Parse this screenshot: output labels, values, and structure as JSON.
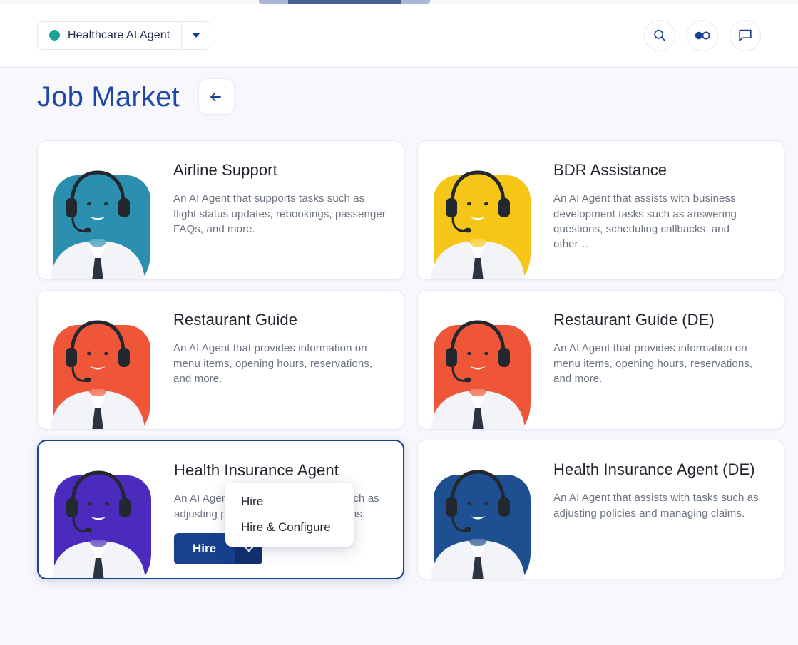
{
  "header": {
    "agent_selector": {
      "name": "Healthcare AI Agent",
      "status_color": "#17a398",
      "caret_icon": "chevron-down-icon"
    },
    "actions": [
      {
        "icon": "search-icon",
        "label": "Search"
      },
      {
        "icon": "connection-toggle-icon",
        "label": "Connections"
      },
      {
        "icon": "chat-bubble-icon",
        "label": "Chat"
      }
    ]
  },
  "page": {
    "title": "Job Market",
    "back_label": "Back",
    "back_icon": "arrow-left-icon",
    "title_color": "#1e46a5"
  },
  "cards": [
    {
      "title": "Airline Support",
      "description": "An AI Agent that supports tasks such as flight status updates, rebookings, passenger FAQs, and more.",
      "bg_color": "#2b8fb0",
      "selected": false
    },
    {
      "title": "BDR Assistance",
      "description": "An AI Agent that assists with business development tasks such as answering questions, scheduling callbacks, and other…",
      "bg_color": "#f5c518",
      "selected": false
    },
    {
      "title": "Restaurant Guide",
      "description": "An AI Agent that provides information on menu items, opening hours, reservations, and more.",
      "bg_color": "#ef5638",
      "selected": false
    },
    {
      "title": "Restaurant Guide (DE)",
      "description": "An AI Agent that provides information on menu items, opening hours, reservations, and more.",
      "bg_color": "#ef5638",
      "selected": false
    },
    {
      "title": "Health Insurance Agent",
      "description": "An AI Agent that assists with tasks such as adjusting policies and managing claims.",
      "bg_color": "#4b2bbd",
      "selected": true,
      "hire_button": {
        "label": "Hire",
        "caret_icon": "chevron-down-icon"
      },
      "menu": {
        "open": true,
        "items": [
          "Hire",
          "Hire & Configure"
        ]
      }
    },
    {
      "title": "Health Insurance Agent (DE)",
      "description": "An AI Agent that assists with tasks such as adjusting policies and managing claims.",
      "bg_color": "#1d4f91",
      "selected": false
    }
  ]
}
